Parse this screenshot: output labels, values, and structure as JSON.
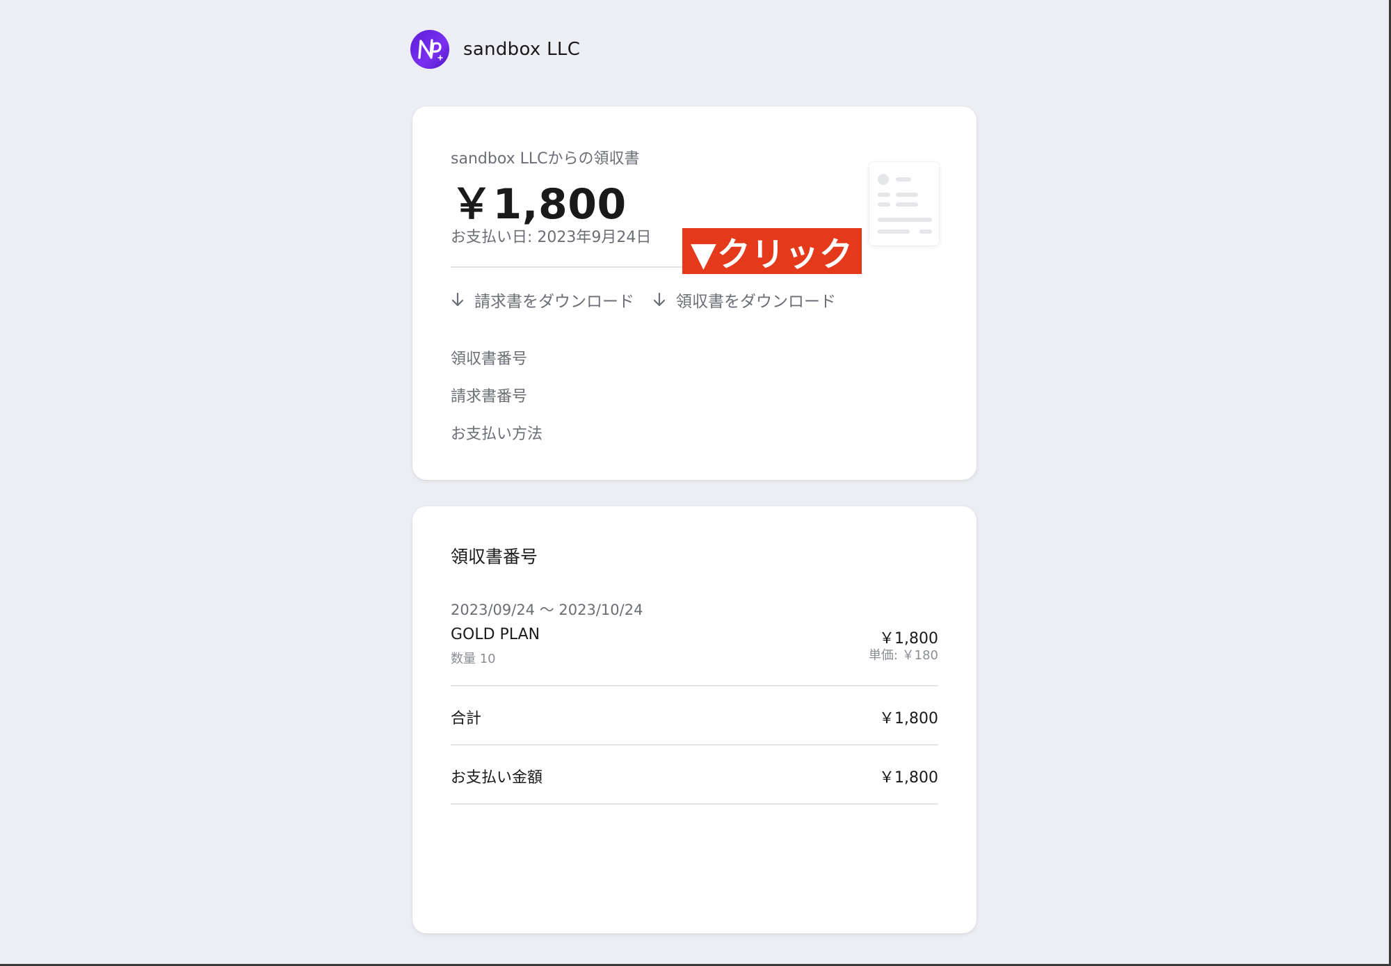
{
  "header": {
    "logo_icon": "np-logo-icon",
    "company_name": "sandbox LLC"
  },
  "summary": {
    "subtitle": "sandbox LLCからの領収書",
    "amount": "￥1,800",
    "payment_date": "お支払い日: 2023年9月24日",
    "callout": "▼クリック",
    "download_invoice": "請求書をダウンロード",
    "download_receipt": "領収書をダウンロード",
    "info_rows": [
      "領収書番号",
      "請求書番号",
      "お支払い方法"
    ]
  },
  "details": {
    "title": "領収書番号",
    "period": "2023/09/24 〜 2023/10/24",
    "item": {
      "name": "GOLD PLAN",
      "quantity": "数量 10",
      "price": "￥1,800",
      "unit_price": "単価: ￥180"
    },
    "total_label": "合計",
    "total_value": "￥1,800",
    "paid_label": "お支払い金額",
    "paid_value": "￥1,800"
  },
  "colors": {
    "background": "#eceef3",
    "brand_purple": "#6a24e6",
    "callout_red": "#e4391b"
  }
}
